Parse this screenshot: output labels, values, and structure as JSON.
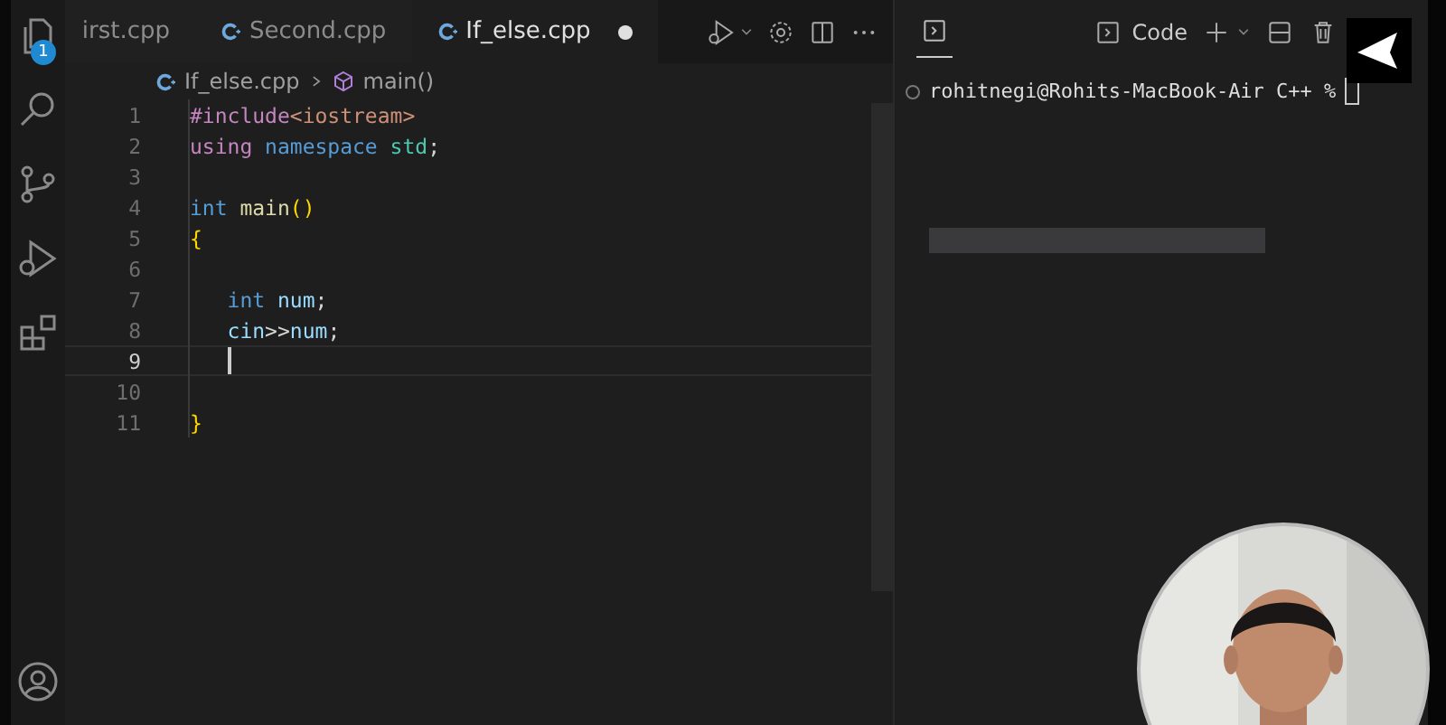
{
  "activity_bar": {
    "badge": "1"
  },
  "tabs": [
    {
      "label": "irst.cpp",
      "icon": false,
      "selected": false,
      "modified": false
    },
    {
      "label": "Second.cpp",
      "icon": true,
      "selected": false,
      "modified": false
    },
    {
      "label": "If_else.cpp",
      "icon": true,
      "selected": true,
      "modified": true
    }
  ],
  "breadcrumb": {
    "file": "If_else.cpp",
    "symbol": "main()"
  },
  "code_lines": [
    {
      "number": "1",
      "current": false,
      "tokens": [
        {
          "text": "#include",
          "kind": "directive"
        },
        {
          "text": "<iostream>",
          "kind": "string"
        }
      ]
    },
    {
      "number": "2",
      "current": false,
      "tokens": [
        {
          "text": "using ",
          "kind": "directive"
        },
        {
          "text": "namespace ",
          "kind": "keyword"
        },
        {
          "text": "std",
          "kind": "type"
        },
        {
          "text": ";",
          "kind": "plain"
        }
      ]
    },
    {
      "number": "3",
      "current": false
    },
    {
      "number": "4",
      "current": false,
      "tokens": [
        {
          "text": "int ",
          "kind": "keyword"
        },
        {
          "text": "main",
          "kind": "function"
        },
        {
          "text": "()",
          "kind": "bracket"
        }
      ]
    },
    {
      "number": "5",
      "current": false,
      "tokens": [
        {
          "text": "{",
          "kind": "bracket"
        }
      ]
    },
    {
      "number": "6",
      "current": false
    },
    {
      "number": "7",
      "current": false,
      "tokens": [
        {
          "text": "   int ",
          "kind": "keyword"
        },
        {
          "text": "num",
          "kind": "variable"
        },
        {
          "text": ";",
          "kind": "plain"
        }
      ]
    },
    {
      "number": "8",
      "current": false,
      "tokens": [
        {
          "text": "   cin",
          "kind": "variable"
        },
        {
          "text": ">>",
          "kind": "plain"
        },
        {
          "text": "num",
          "kind": "variable"
        },
        {
          "text": ";",
          "kind": "plain"
        }
      ]
    },
    {
      "number": "9",
      "current": true
    },
    {
      "number": "10",
      "current": false
    },
    {
      "number": "11",
      "current": false,
      "tokens": [
        {
          "text": "}",
          "kind": "bracket"
        }
      ]
    }
  ],
  "terminal": {
    "profile": "Code",
    "prompt": "rohitnegi@Rohits-MacBook-Air C++ %"
  }
}
